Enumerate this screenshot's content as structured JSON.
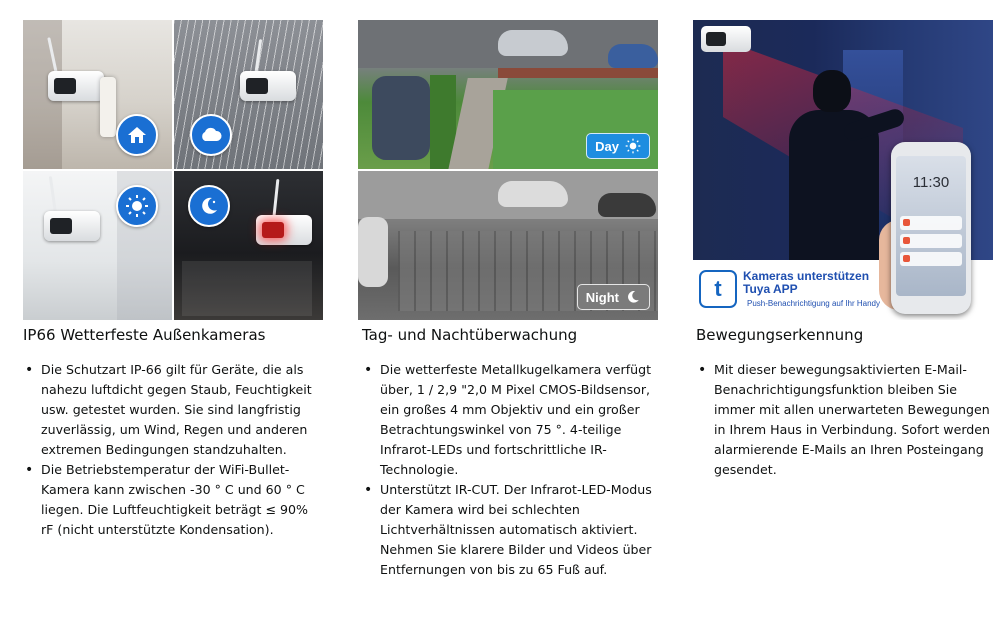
{
  "columns": [
    {
      "heading": "IP66 Wetterfeste Außenkameras",
      "bullets": [
        "Die Schutzart IP-66 gilt für Geräte, die als nahezu luftdicht gegen Staub, Feuchtigkeit usw. getestet wurden. Sie sind langfristig zuverlässig, um Wind, Regen und anderen extremen Bedingungen standzuhalten.",
        "Die Betriebstemperatur der WiFi-Bullet-Kamera kann zwischen -30 ° C und 60 ° C liegen. Die Luftfeuchtigkeit beträgt ≤ 90% rF (nicht unterstützte Kondensation)."
      ],
      "weather_icons": [
        "home-icon",
        "cloud-icon",
        "sun-icon",
        "moon-icon"
      ]
    },
    {
      "heading": "Tag- und Nachtüberwachung",
      "day_label": "Day",
      "night_label": "Night",
      "bullets": [
        "Die wetterfeste Metallkugelkamera verfügt über, 1 / 2,9 \"2,0 M Pixel CMOS-Bildsensor, ein großes 4 mm Objektiv und ein großer Betrachtungswinkel von 75 °. 4-teilige Infrarot-LEDs und fortschrittliche IR-Technologie.",
        "Unterstützt IR-CUT. Der Infrarot-LED-Modus der Kamera wird bei schlechten Lichtverhältnissen automatisch aktiviert. Nehmen Sie klarere Bilder und Videos über Entfernungen von bis zu 65 Fuß auf."
      ]
    },
    {
      "heading": "Bewegungserkennung",
      "app_line1": "Kameras unterstützen",
      "app_line2": "Tuya APP",
      "app_line3": "Push-Benachrichtigung auf Ihr Handy",
      "phone_time": "11:30",
      "bullets": [
        "Mit dieser bewegungsaktivierten E-Mail-Benachrichtigungsfunktion bleiben Sie immer mit allen unerwarteten Bewegungen in Ihrem Haus in Verbindung. Sofort werden alarmierende E-Mails an Ihren Posteingang gesendet."
      ]
    }
  ],
  "colors": {
    "accent_blue": "#1a6fd3",
    "label_blue": "#1e8de0",
    "text": "#0f1111"
  }
}
